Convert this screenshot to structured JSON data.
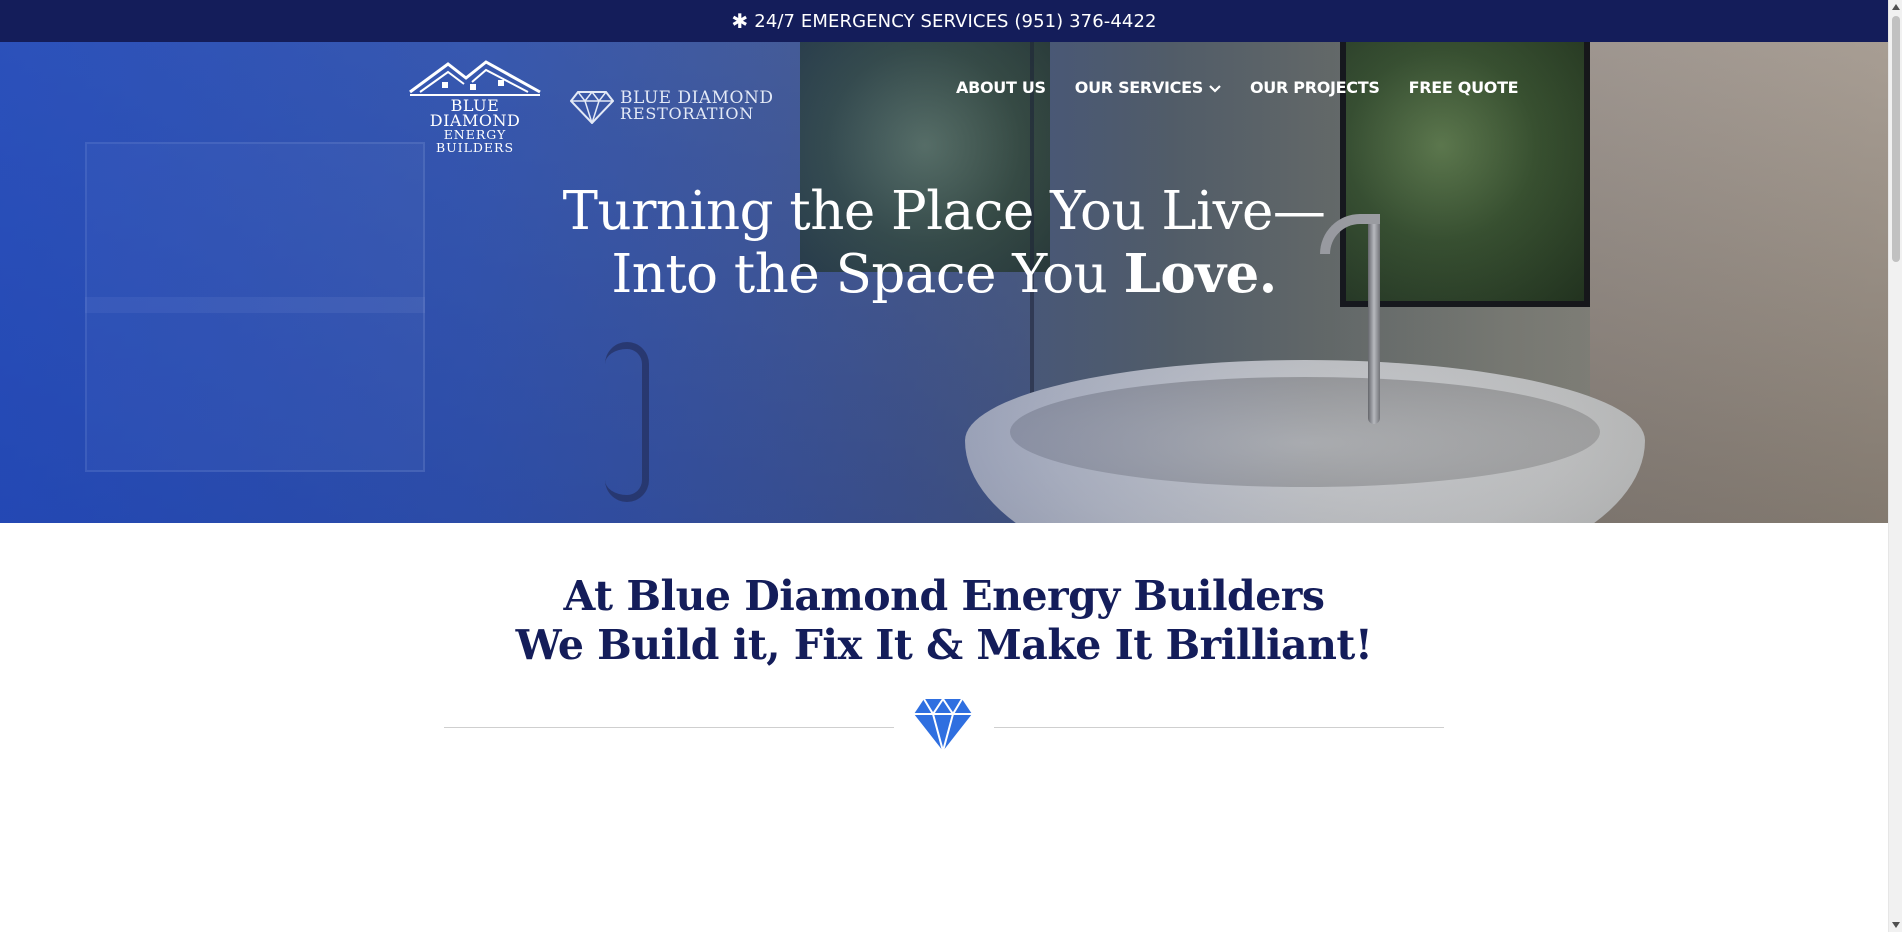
{
  "topbar": {
    "icon": "asterisk-icon",
    "text": "24/7 EMERGENCY SERVICES (951) 376-4422"
  },
  "header": {
    "logo_primary": {
      "line1": "BLUE DIAMOND",
      "line2": "ENERGY BUILDERS",
      "icon": "house-roof-logo-icon"
    },
    "logo_secondary": {
      "line1": "BLUE DIAMOND",
      "line2": "RESTORATION",
      "icon": "diamond-logo-icon"
    },
    "nav": [
      {
        "label": "ABOUT US"
      },
      {
        "label": "OUR SERVICES",
        "has_dropdown": true,
        "icon": "chevron-down-icon"
      },
      {
        "label": "OUR PROJECTS"
      },
      {
        "label": "FREE QUOTE"
      }
    ]
  },
  "hero": {
    "line1": "Turning the Place You Live—",
    "line2_prefix": "Into the Space You ",
    "line2_emphasis": "Love."
  },
  "intro": {
    "line1": "At Blue Diamond Energy Builders",
    "line2": "We Build it, Fix It & Make It Brilliant!",
    "divider_icon": "diamond-icon"
  },
  "colors": {
    "navy": "#141d5a",
    "accent_blue": "#2f6fe0",
    "white": "#ffffff"
  }
}
